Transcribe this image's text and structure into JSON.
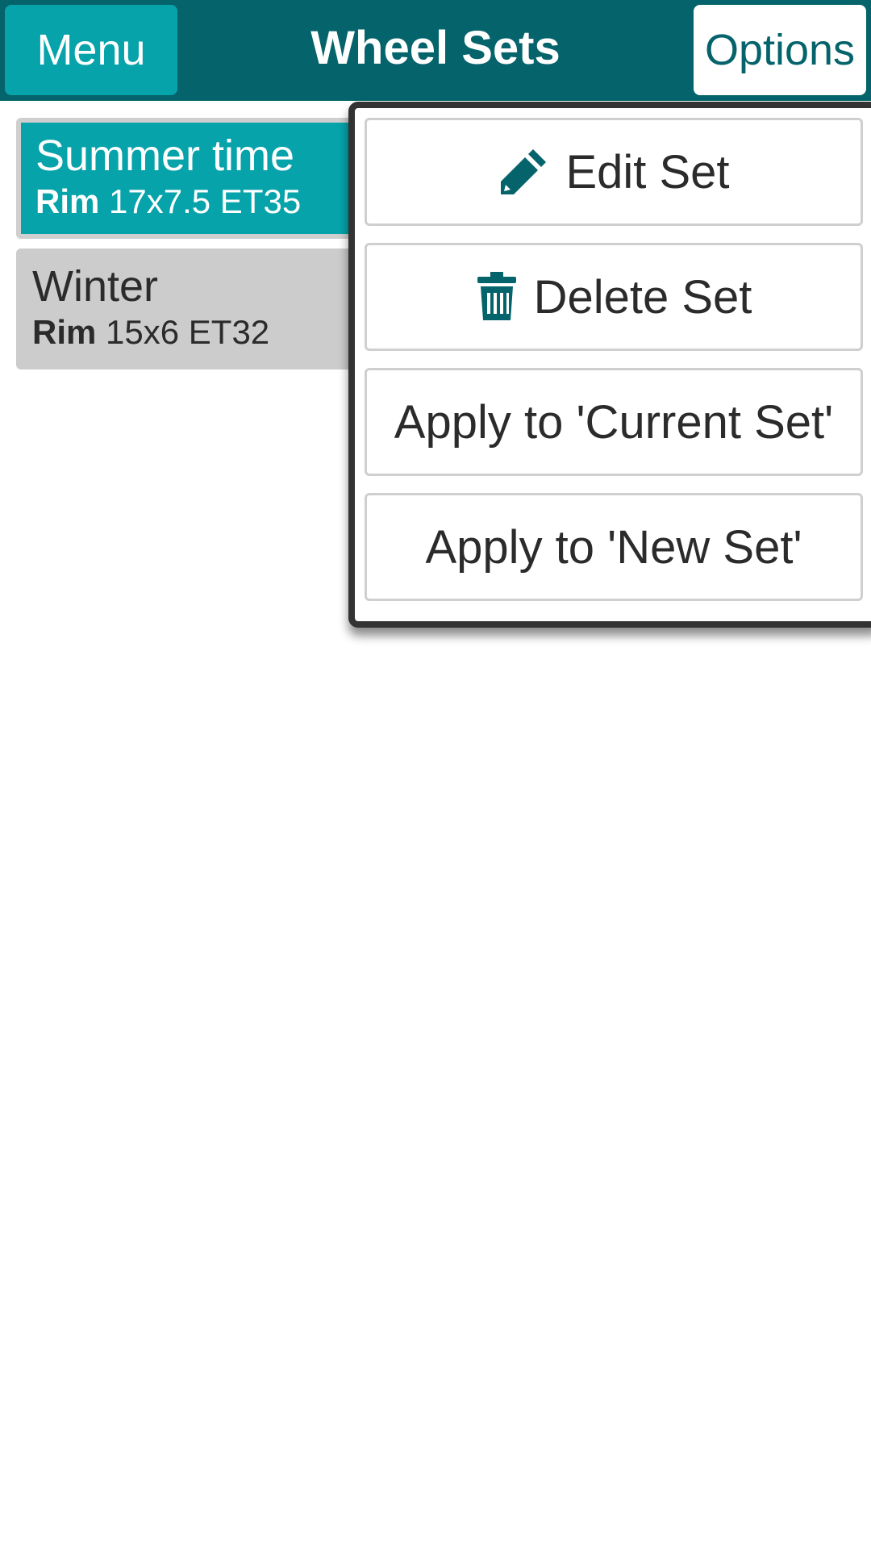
{
  "header": {
    "menu_label": "Menu",
    "title": "Wheel Sets",
    "options_label": "Options"
  },
  "sets": [
    {
      "name": "Summer time",
      "rim_label": "Rim",
      "rim_value": "17x7.5 ET35",
      "selected": true
    },
    {
      "name": "Winter",
      "rim_label": "Rim",
      "rim_value": "15x6 ET32",
      "selected": false
    }
  ],
  "popup": {
    "edit": {
      "label": "Edit Set",
      "icon": "pencil-icon"
    },
    "delete": {
      "label": "Delete Set",
      "icon": "trash-icon"
    },
    "apply_current": {
      "label": "Apply to 'Current Set'"
    },
    "apply_new": {
      "label": "Apply to 'New Set'"
    }
  },
  "colors": {
    "header_bg": "#05636b",
    "accent": "#06a3ab",
    "item_bg": "#cccccc",
    "popup_border": "#333333"
  }
}
